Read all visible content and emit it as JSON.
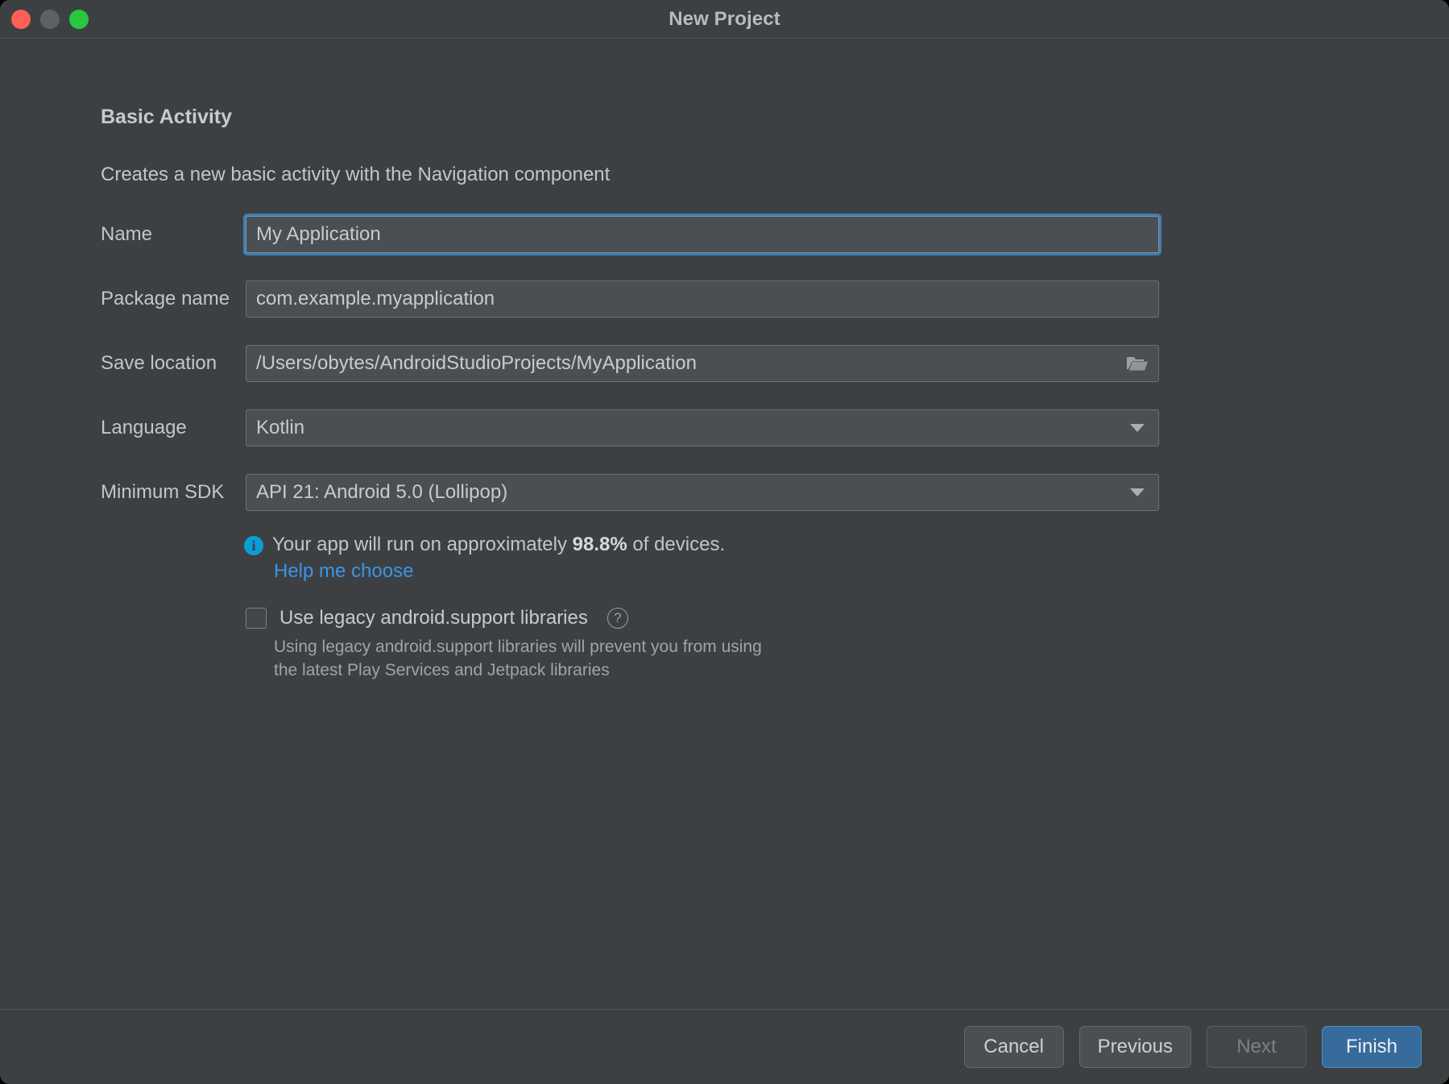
{
  "window": {
    "title": "New Project",
    "traffic_lights": [
      "close-button",
      "minimize-button",
      "zoom-button"
    ]
  },
  "colors": {
    "window_bg": "#3c4043",
    "field_bg": "#4a4f53",
    "focus_ring": "#3c7eb8",
    "link": "#3d93e8",
    "info_icon": "#0a9ed6",
    "primary_button": "#366b9c",
    "close_light": "#ff5f57",
    "minimize_light": "#5c6165",
    "zoom_light": "#28c840"
  },
  "header": {
    "title": "Basic Activity",
    "description": "Creates a new basic activity with the Navigation component"
  },
  "form": {
    "name": {
      "label": "Name",
      "value": "My Application",
      "focused": true
    },
    "package_name": {
      "label": "Package name",
      "value": "com.example.myapplication"
    },
    "save_location": {
      "label": "Save location",
      "value": "/Users/obytes/AndroidStudioProjects/MyApplication",
      "trailing_icon": "folder-icon"
    },
    "language": {
      "label": "Language",
      "value": "Kotlin",
      "trailing_icon": "chevron-down-icon"
    },
    "minimum_sdk": {
      "label": "Minimum SDK",
      "value": "API 21: Android 5.0 (Lollipop)",
      "trailing_icon": "chevron-down-icon"
    }
  },
  "info": {
    "icon": "info-icon",
    "text_before": "Your app will run on approximately ",
    "percentage": "98.8%",
    "text_after": " of devices.",
    "link": "Help me choose"
  },
  "legacy": {
    "checked": false,
    "label": "Use legacy android.support libraries",
    "help_icon": "question-mark-icon",
    "note": "Using legacy android.support libraries will prevent you from using the latest Play Services and Jetpack libraries"
  },
  "footer": {
    "cancel": "Cancel",
    "previous": "Previous",
    "next": "Next",
    "finish": "Finish"
  }
}
